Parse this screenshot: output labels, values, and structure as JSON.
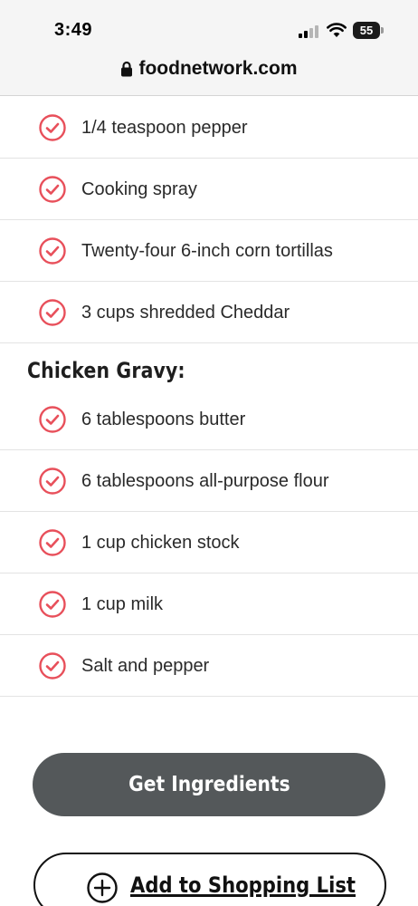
{
  "status_bar": {
    "time": "3:49",
    "battery_level": "55",
    "icons": [
      "signal-icon",
      "wifi-icon",
      "battery-icon"
    ]
  },
  "browser": {
    "url": "foodnetwork.com",
    "lock_icon": "lock-icon"
  },
  "ingredients_top": [
    {
      "text": "1/4 teaspoon pepper"
    },
    {
      "text": "Cooking spray"
    },
    {
      "text": "Twenty-four 6-inch corn tortillas"
    },
    {
      "text": "3 cups shredded Cheddar"
    }
  ],
  "section": {
    "title": "Chicken Gravy:"
  },
  "ingredients_gravy": [
    {
      "text": "6 tablespoons butter"
    },
    {
      "text": "6 tablespoons all-purpose flour"
    },
    {
      "text": "1 cup chicken stock"
    },
    {
      "text": "1 cup milk"
    },
    {
      "text": "Salt and pepper"
    }
  ],
  "actions": {
    "get_ingredients": "Get Ingredients",
    "add_to_shopping_list": "Add to Shopping List"
  },
  "colors": {
    "check_red": "#e8505b",
    "button_gray": "#54585a",
    "divider": "#e3e3e3"
  }
}
